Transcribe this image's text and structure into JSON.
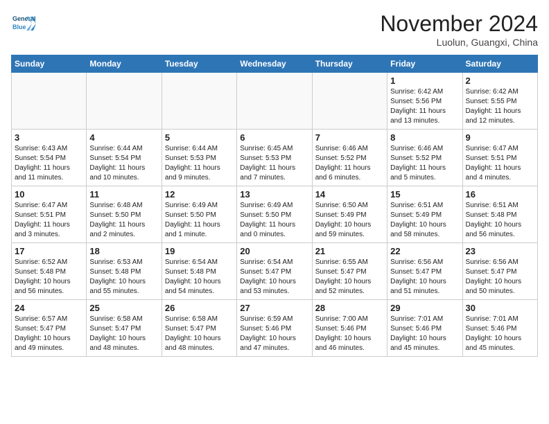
{
  "logo": {
    "line1": "General",
    "line2": "Blue"
  },
  "title": "November 2024",
  "location": "Luolun, Guangxi, China",
  "weekdays": [
    "Sunday",
    "Monday",
    "Tuesday",
    "Wednesday",
    "Thursday",
    "Friday",
    "Saturday"
  ],
  "weeks": [
    [
      {
        "day": "",
        "info": ""
      },
      {
        "day": "",
        "info": ""
      },
      {
        "day": "",
        "info": ""
      },
      {
        "day": "",
        "info": ""
      },
      {
        "day": "",
        "info": ""
      },
      {
        "day": "1",
        "info": "Sunrise: 6:42 AM\nSunset: 5:56 PM\nDaylight: 11 hours\nand 13 minutes."
      },
      {
        "day": "2",
        "info": "Sunrise: 6:42 AM\nSunset: 5:55 PM\nDaylight: 11 hours\nand 12 minutes."
      }
    ],
    [
      {
        "day": "3",
        "info": "Sunrise: 6:43 AM\nSunset: 5:54 PM\nDaylight: 11 hours\nand 11 minutes."
      },
      {
        "day": "4",
        "info": "Sunrise: 6:44 AM\nSunset: 5:54 PM\nDaylight: 11 hours\nand 10 minutes."
      },
      {
        "day": "5",
        "info": "Sunrise: 6:44 AM\nSunset: 5:53 PM\nDaylight: 11 hours\nand 9 minutes."
      },
      {
        "day": "6",
        "info": "Sunrise: 6:45 AM\nSunset: 5:53 PM\nDaylight: 11 hours\nand 7 minutes."
      },
      {
        "day": "7",
        "info": "Sunrise: 6:46 AM\nSunset: 5:52 PM\nDaylight: 11 hours\nand 6 minutes."
      },
      {
        "day": "8",
        "info": "Sunrise: 6:46 AM\nSunset: 5:52 PM\nDaylight: 11 hours\nand 5 minutes."
      },
      {
        "day": "9",
        "info": "Sunrise: 6:47 AM\nSunset: 5:51 PM\nDaylight: 11 hours\nand 4 minutes."
      }
    ],
    [
      {
        "day": "10",
        "info": "Sunrise: 6:47 AM\nSunset: 5:51 PM\nDaylight: 11 hours\nand 3 minutes."
      },
      {
        "day": "11",
        "info": "Sunrise: 6:48 AM\nSunset: 5:50 PM\nDaylight: 11 hours\nand 2 minutes."
      },
      {
        "day": "12",
        "info": "Sunrise: 6:49 AM\nSunset: 5:50 PM\nDaylight: 11 hours\nand 1 minute."
      },
      {
        "day": "13",
        "info": "Sunrise: 6:49 AM\nSunset: 5:50 PM\nDaylight: 11 hours\nand 0 minutes."
      },
      {
        "day": "14",
        "info": "Sunrise: 6:50 AM\nSunset: 5:49 PM\nDaylight: 10 hours\nand 59 minutes."
      },
      {
        "day": "15",
        "info": "Sunrise: 6:51 AM\nSunset: 5:49 PM\nDaylight: 10 hours\nand 58 minutes."
      },
      {
        "day": "16",
        "info": "Sunrise: 6:51 AM\nSunset: 5:48 PM\nDaylight: 10 hours\nand 56 minutes."
      }
    ],
    [
      {
        "day": "17",
        "info": "Sunrise: 6:52 AM\nSunset: 5:48 PM\nDaylight: 10 hours\nand 56 minutes."
      },
      {
        "day": "18",
        "info": "Sunrise: 6:53 AM\nSunset: 5:48 PM\nDaylight: 10 hours\nand 55 minutes."
      },
      {
        "day": "19",
        "info": "Sunrise: 6:54 AM\nSunset: 5:48 PM\nDaylight: 10 hours\nand 54 minutes."
      },
      {
        "day": "20",
        "info": "Sunrise: 6:54 AM\nSunset: 5:47 PM\nDaylight: 10 hours\nand 53 minutes."
      },
      {
        "day": "21",
        "info": "Sunrise: 6:55 AM\nSunset: 5:47 PM\nDaylight: 10 hours\nand 52 minutes."
      },
      {
        "day": "22",
        "info": "Sunrise: 6:56 AM\nSunset: 5:47 PM\nDaylight: 10 hours\nand 51 minutes."
      },
      {
        "day": "23",
        "info": "Sunrise: 6:56 AM\nSunset: 5:47 PM\nDaylight: 10 hours\nand 50 minutes."
      }
    ],
    [
      {
        "day": "24",
        "info": "Sunrise: 6:57 AM\nSunset: 5:47 PM\nDaylight: 10 hours\nand 49 minutes."
      },
      {
        "day": "25",
        "info": "Sunrise: 6:58 AM\nSunset: 5:47 PM\nDaylight: 10 hours\nand 48 minutes."
      },
      {
        "day": "26",
        "info": "Sunrise: 6:58 AM\nSunset: 5:47 PM\nDaylight: 10 hours\nand 48 minutes."
      },
      {
        "day": "27",
        "info": "Sunrise: 6:59 AM\nSunset: 5:46 PM\nDaylight: 10 hours\nand 47 minutes."
      },
      {
        "day": "28",
        "info": "Sunrise: 7:00 AM\nSunset: 5:46 PM\nDaylight: 10 hours\nand 46 minutes."
      },
      {
        "day": "29",
        "info": "Sunrise: 7:01 AM\nSunset: 5:46 PM\nDaylight: 10 hours\nand 45 minutes."
      },
      {
        "day": "30",
        "info": "Sunrise: 7:01 AM\nSunset: 5:46 PM\nDaylight: 10 hours\nand 45 minutes."
      }
    ]
  ]
}
